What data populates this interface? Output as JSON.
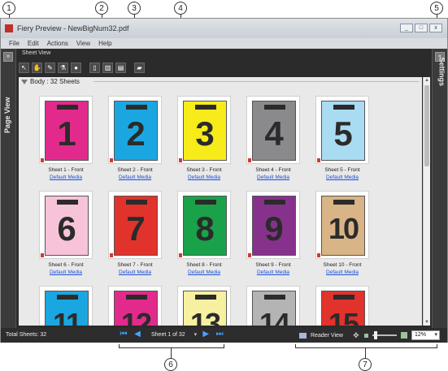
{
  "callouts": [
    "1",
    "2",
    "3",
    "4",
    "5",
    "6",
    "7"
  ],
  "window": {
    "title": "Fiery Preview - NewBigNum32.pdf",
    "controls": [
      "_",
      "□",
      "x"
    ]
  },
  "menu": [
    "File",
    "Edit",
    "Actions",
    "View",
    "Help"
  ],
  "left_panel": {
    "label": "Page View",
    "button": "»"
  },
  "right_panel": {
    "label": "Settings",
    "button": "«"
  },
  "sheet_view": {
    "title": "Sheet View",
    "tools": [
      "select-icon",
      "hand-icon",
      "pencil-icon",
      "eyedrop-icon",
      "pin-icon",
      "page-icon",
      "spread-icon",
      "booklet-icon",
      "book-icon"
    ],
    "section_label": "Body : 32 Sheets"
  },
  "sheets": [
    {
      "num": "1",
      "color": "#e22a8c",
      "caption": "Sheet 1 - Front",
      "media": "Default Media"
    },
    {
      "num": "2",
      "color": "#1aa7e1",
      "caption": "Sheet 2 - Front",
      "media": "Default Media"
    },
    {
      "num": "3",
      "color": "#f7ec1a",
      "caption": "Sheet 3 - Front",
      "media": "Default Media"
    },
    {
      "num": "4",
      "color": "#8a8a8c",
      "caption": "Sheet 4 - Front",
      "media": "Default Media"
    },
    {
      "num": "5",
      "color": "#a9dcf2",
      "caption": "Sheet 5 - Front",
      "media": "Default Media"
    },
    {
      "num": "6",
      "color": "#f7c3d8",
      "caption": "Sheet 6 - Front",
      "media": "Default Media"
    },
    {
      "num": "7",
      "color": "#e2322c",
      "caption": "Sheet 7 - Front",
      "media": "Default Media"
    },
    {
      "num": "8",
      "color": "#1aa24a",
      "caption": "Sheet 8 - Front",
      "media": "Default Media"
    },
    {
      "num": "9",
      "color": "#86328c",
      "caption": "Sheet 9 - Front",
      "media": "Default Media"
    },
    {
      "num": "10",
      "color": "#d8b486",
      "caption": "Sheet 10 - Front",
      "media": "Default Media"
    },
    {
      "num": "11",
      "color": "#1aa7e1",
      "caption": "",
      "media": ""
    },
    {
      "num": "12",
      "color": "#e22a8c",
      "caption": "",
      "media": ""
    },
    {
      "num": "13",
      "color": "#f7f0a0",
      "caption": "",
      "media": ""
    },
    {
      "num": "14",
      "color": "#b4b4b4",
      "caption": "",
      "media": ""
    },
    {
      "num": "15",
      "color": "#e2322c",
      "caption": "",
      "media": ""
    }
  ],
  "status": {
    "total": "Total Sheets: 32",
    "sheet_selector": "Sheet 1 of 32",
    "reader_view": "Reader View",
    "zoom": "12%",
    "nav_icons": [
      "first-icon",
      "prev-icon",
      "next-icon",
      "last-icon"
    ]
  }
}
